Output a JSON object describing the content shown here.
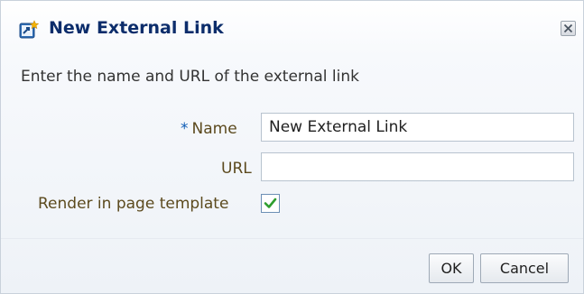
{
  "dialog": {
    "title": "New External Link",
    "title_icon": "new-link-icon",
    "close_icon": "close-icon"
  },
  "instructions": "Enter the name and URL of the external link",
  "form": {
    "name": {
      "required_marker": "*",
      "label": "Name",
      "value": "New External Link"
    },
    "url": {
      "label": "URL",
      "value": ""
    },
    "render_in_template": {
      "label": "Render in page template",
      "checked": true
    }
  },
  "buttons": {
    "ok_label": "OK",
    "cancel_label": "Cancel"
  },
  "colors": {
    "title": "#0c2d6b",
    "label": "#5c4a1e",
    "required_star": "#0d5cb5",
    "checkmark": "#2e9e2e"
  }
}
